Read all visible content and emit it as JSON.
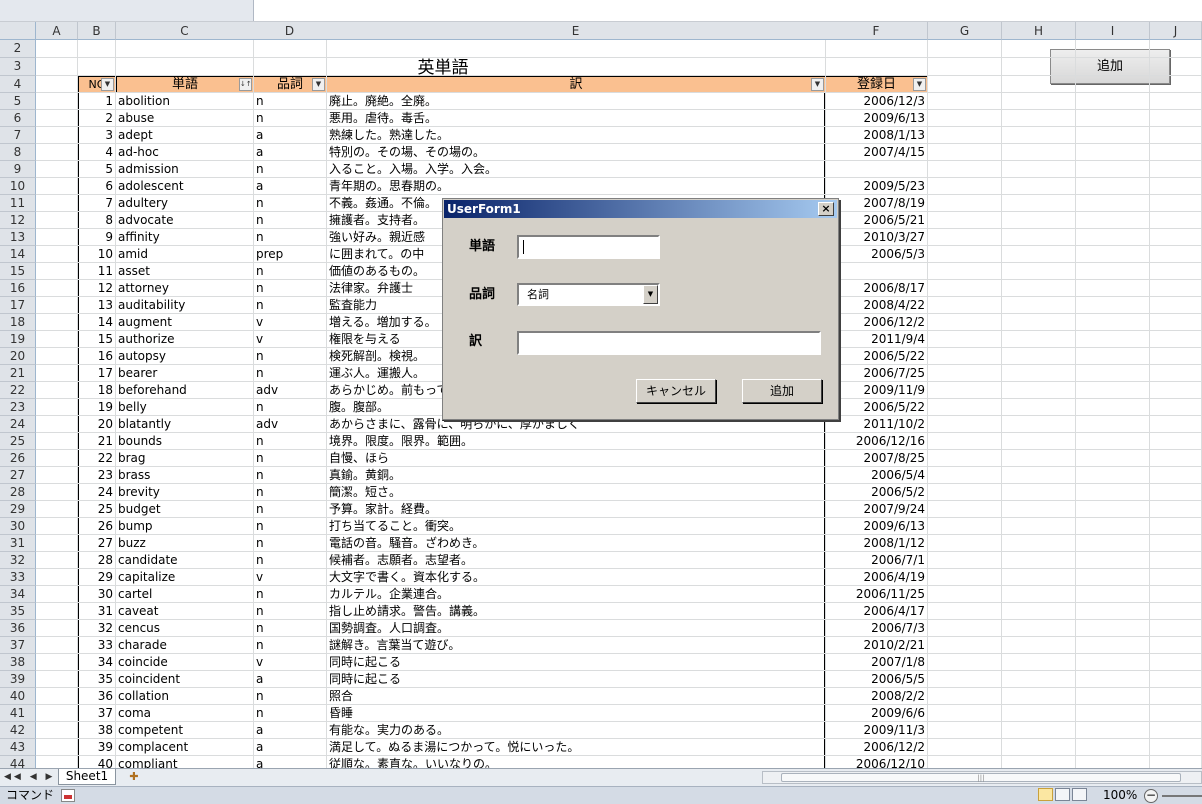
{
  "columns": [
    "A",
    "B",
    "C",
    "D",
    "E",
    "F",
    "G",
    "H",
    "I",
    "J"
  ],
  "rows_header": [
    "2",
    "3",
    "4",
    "5",
    "6",
    "7",
    "8",
    "9",
    "10",
    "11",
    "12",
    "13",
    "14",
    "15",
    "16",
    "17",
    "18",
    "19",
    "20",
    "21",
    "22",
    "23",
    "24",
    "25",
    "26",
    "27",
    "28",
    "29",
    "30",
    "31",
    "32",
    "33",
    "34",
    "35",
    "36",
    "37",
    "38",
    "39",
    "40",
    "41",
    "42",
    "43",
    "44"
  ],
  "sheet": {
    "title": "英単語",
    "headers": {
      "no": "NO",
      "word": "単語",
      "pos": "品詞",
      "translation": "訳",
      "date": "登録日"
    },
    "add_button": "追加",
    "rows": [
      [
        "1",
        "abolition",
        "n",
        "廃止。廃絶。全廃。",
        "2006/12/3"
      ],
      [
        "2",
        "abuse",
        "n",
        "悪用。虐待。毒舌。",
        "2009/6/13"
      ],
      [
        "3",
        "adept",
        "a",
        "熟練した。熟達した。",
        "2008/1/13"
      ],
      [
        "4",
        "ad-hoc",
        "a",
        "特別の。その場、その場の。",
        "2007/4/15"
      ],
      [
        "5",
        "admission",
        "n",
        "入ること。入場。入学。入会。",
        ""
      ],
      [
        "6",
        "adolescent",
        "a",
        "青年期の。思春期の。",
        "2009/5/23"
      ],
      [
        "7",
        "adultery",
        "n",
        "不義。姦通。不倫。",
        "2007/8/19"
      ],
      [
        "8",
        "advocate",
        "n",
        "擁護者。支持者。",
        "2006/5/21"
      ],
      [
        "9",
        "affinity",
        "n",
        "強い好み。親近感",
        "2010/3/27"
      ],
      [
        "10",
        "amid",
        "prep",
        "に囲まれて。の中",
        "2006/5/3"
      ],
      [
        "11",
        "asset",
        "n",
        "価値のあるもの。",
        ""
      ],
      [
        "12",
        "attorney",
        "n",
        "法律家。弁護士",
        "2006/8/17"
      ],
      [
        "13",
        "auditability",
        "n",
        "監査能力",
        "2008/4/22"
      ],
      [
        "14",
        "augment",
        "v",
        "増える。増加する。",
        "2006/12/2"
      ],
      [
        "15",
        "authorize",
        "v",
        "権限を与える",
        "2011/9/4"
      ],
      [
        "16",
        "autopsy",
        "n",
        "検死解剖。検視。",
        "2006/5/22"
      ],
      [
        "17",
        "bearer",
        "n",
        "運ぶ人。運搬人。",
        "2006/7/25"
      ],
      [
        "18",
        "beforehand",
        "adv",
        "あらかじめ。前もって",
        "2009/11/9"
      ],
      [
        "19",
        "belly",
        "n",
        "腹。腹部。",
        "2006/5/22"
      ],
      [
        "20",
        "blatantly",
        "adv",
        "あからさまに、露骨に、明らかに、厚かましく",
        "2011/10/2"
      ],
      [
        "21",
        "bounds",
        "n",
        "境界。限度。限界。範囲。",
        "2006/12/16"
      ],
      [
        "22",
        "brag",
        "n",
        "自慢、ほら",
        "2007/8/25"
      ],
      [
        "23",
        "brass",
        "n",
        "真鍮。黄銅。",
        "2006/5/4"
      ],
      [
        "24",
        "brevity",
        "n",
        "簡潔。短さ。",
        "2006/5/2"
      ],
      [
        "25",
        "budget",
        "n",
        "予算。家計。経費。",
        "2007/9/24"
      ],
      [
        "26",
        "bump",
        "n",
        "打ち当てること。衝突。",
        "2009/6/13"
      ],
      [
        "27",
        "buzz",
        "n",
        "電話の音。騒音。ざわめき。",
        "2008/1/12"
      ],
      [
        "28",
        "candidate",
        "n",
        "候補者。志願者。志望者。",
        "2006/7/1"
      ],
      [
        "29",
        "capitalize",
        "v",
        "大文字で書く。資本化する。",
        "2006/4/19"
      ],
      [
        "30",
        "cartel",
        "n",
        "カルテル。企業連合。",
        "2006/11/25"
      ],
      [
        "31",
        "caveat",
        "n",
        "指し止め請求。警告。講義。",
        "2006/4/17"
      ],
      [
        "32",
        "cencus",
        "n",
        "国勢調査。人口調査。",
        "2006/7/3"
      ],
      [
        "33",
        "charade",
        "n",
        "謎解き。言葉当て遊び。",
        "2010/2/21"
      ],
      [
        "34",
        "coincide",
        "v",
        "同時に起こる",
        "2007/1/8"
      ],
      [
        "35",
        "coincident",
        "a",
        "同時に起こる",
        "2006/5/5"
      ],
      [
        "36",
        "collation",
        "n",
        "照合",
        "2008/2/2"
      ],
      [
        "37",
        "coma",
        "n",
        "昏睡",
        "2009/6/6"
      ],
      [
        "38",
        "competent",
        "a",
        "有能な。実力のある。",
        "2009/11/3"
      ],
      [
        "39",
        "complacent",
        "a",
        "満足して。ぬるま湯につかって。悦にいった。",
        "2006/12/2"
      ],
      [
        "40",
        "compliant",
        "a",
        "従順な。素直な。いいなりの。",
        "2006/12/10"
      ]
    ]
  },
  "tabs": {
    "sheet_name": "Sheet1"
  },
  "status": {
    "mode": "コマンド",
    "zoom": "100%",
    "zoom_minus": "−"
  },
  "dialog": {
    "title": "UserForm1",
    "close": "×",
    "labels": {
      "word": "単語",
      "pos": "品詞",
      "translation": "訳"
    },
    "word_value": "",
    "pos_selected": "名詞",
    "translation_value": "",
    "cancel": "キャンセル",
    "add": "追加"
  }
}
